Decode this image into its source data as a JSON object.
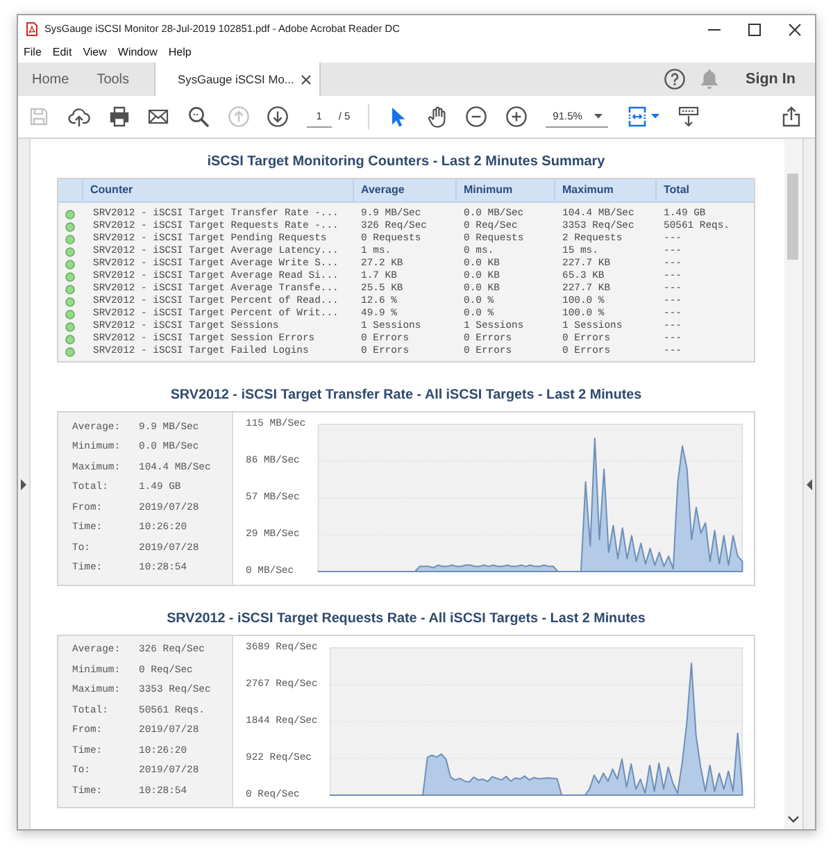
{
  "window": {
    "title": "SysGauge iSCSI Monitor 28-Jul-2019 102851.pdf - Adobe Acrobat Reader DC"
  },
  "menu": [
    "File",
    "Edit",
    "View",
    "Window",
    "Help"
  ],
  "tabs": [
    {
      "label": "Home",
      "kind": "nav",
      "selected": false
    },
    {
      "label": "Tools",
      "kind": "nav",
      "selected": false
    },
    {
      "label": "SysGauge iSCSI Mo...",
      "kind": "document",
      "selected": true
    }
  ],
  "account": {
    "sign_in": "Sign In"
  },
  "toolbar": {
    "file_tools": [
      {
        "kind": "save",
        "disabled": true
      },
      {
        "kind": "upload",
        "disabled": false
      },
      {
        "kind": "print",
        "disabled": false
      },
      {
        "kind": "email",
        "disabled": false
      },
      {
        "kind": "search",
        "disabled": false
      },
      {
        "kind": "previous_page",
        "disabled": true
      },
      {
        "kind": "next_page",
        "disabled": false
      }
    ],
    "page": {
      "value": "1",
      "total": "/ 5"
    },
    "view_tools": [
      {
        "kind": "select",
        "selected": true
      },
      {
        "kind": "hand",
        "selected": false
      },
      {
        "kind": "zoom_out",
        "selected": false
      },
      {
        "kind": "zoom_in",
        "selected": false
      }
    ],
    "zoom": {
      "value": "91.5%"
    },
    "display_tools": [
      {
        "kind": "page_display"
      },
      {
        "kind": "scroll_mode"
      }
    ],
    "end_tools": [
      {
        "kind": "share"
      }
    ]
  },
  "document": {
    "summary": {
      "title": "iSCSI Target Monitoring Counters - Last 2 Minutes Summary",
      "columns": [
        "Counter",
        "Average",
        "Minimum",
        "Maximum",
        "Total"
      ],
      "rows": [
        {
          "ok": true,
          "cells": [
            "SRV2012 - iSCSI Target Transfer Rate -...",
            "9.9 MB/Sec",
            "0.0 MB/Sec",
            "104.4 MB/Sec",
            "1.49 GB"
          ]
        },
        {
          "ok": true,
          "cells": [
            "SRV2012 - iSCSI Target Requests Rate -...",
            "326 Req/Sec",
            "0 Req/Sec",
            "3353 Req/Sec",
            "50561 Reqs."
          ]
        },
        {
          "ok": true,
          "cells": [
            "SRV2012 - iSCSI Target Pending Requests",
            "0 Requests",
            "0 Requests",
            "2 Requests",
            "---"
          ]
        },
        {
          "ok": true,
          "cells": [
            "SRV2012 - iSCSI Target Average Latency...",
            "1 ms.",
            "0 ms.",
            "15 ms.",
            "---"
          ]
        },
        {
          "ok": true,
          "cells": [
            "SRV2012 - iSCSI Target Average Write S...",
            "27.2 KB",
            "0.0 KB",
            "227.7 KB",
            "---"
          ]
        },
        {
          "ok": true,
          "cells": [
            "SRV2012 - iSCSI Target Average Read Si...",
            "1.7 KB",
            "0.0 KB",
            "65.3 KB",
            "---"
          ]
        },
        {
          "ok": true,
          "cells": [
            "SRV2012 - iSCSI Target Average Transfe...",
            "25.5 KB",
            "0.0 KB",
            "227.7 KB",
            "---"
          ]
        },
        {
          "ok": true,
          "cells": [
            "SRV2012 - iSCSI Target Percent of Read...",
            "12.6 %",
            "0.0 %",
            "100.0 %",
            "---"
          ]
        },
        {
          "ok": true,
          "cells": [
            "SRV2012 - iSCSI Target Percent of Writ...",
            "49.9 %",
            "0.0 %",
            "100.0 %",
            "---"
          ]
        },
        {
          "ok": true,
          "cells": [
            "SRV2012 - iSCSI Target Sessions",
            "1 Sessions",
            "1 Sessions",
            "1 Sessions",
            "---"
          ]
        },
        {
          "ok": true,
          "cells": [
            "SRV2012 - iSCSI Target Session Errors",
            "0 Errors",
            "0 Errors",
            "0 Errors",
            "---"
          ]
        },
        {
          "ok": true,
          "cells": [
            "SRV2012 - iSCSI Target Failed Logins",
            "0 Errors",
            "0 Errors",
            "0 Errors",
            "---"
          ]
        }
      ]
    },
    "charts": [
      {
        "stats": [
          {
            "label": "Average:",
            "value": "9.9 MB/Sec"
          },
          {
            "label": "Minimum:",
            "value": "0.0 MB/Sec"
          },
          {
            "label": "Maximum:",
            "value": "104.4 MB/Sec"
          },
          {
            "label": "Total:",
            "value": "1.49 GB"
          },
          {
            "label": "From:",
            "value": "2019/07/28"
          },
          {
            "label": "Time:",
            "value": "10:26:20"
          },
          {
            "label": "To:",
            "value": "2019/07/28"
          },
          {
            "label": "Time:",
            "value": "10:28:54"
          }
        ],
        "chart_data": {
          "type": "area",
          "title": "SRV2012 - iSCSI Target Transfer Rate - All iSCSI Targets - Last 2 Minutes",
          "grid": true,
          "ylim": [
            0,
            115
          ],
          "yticks": [
            {
              "value": 0,
              "label": "0 MB/Sec"
            },
            {
              "value": 28.75,
              "label": "29 MB/Sec"
            },
            {
              "value": 57.5,
              "label": "57 MB/Sec"
            },
            {
              "value": 86.25,
              "label": "86 MB/Sec"
            },
            {
              "value": 115,
              "label": "115 MB/Sec"
            }
          ],
          "values": [
            0,
            0,
            0,
            0,
            0,
            0,
            0,
            0,
            0,
            0,
            0,
            0,
            0,
            0,
            0,
            0,
            0,
            0,
            0,
            0,
            0,
            0,
            4,
            4,
            4,
            3,
            5,
            4,
            4,
            5,
            4,
            4,
            5,
            5,
            4,
            4,
            5,
            4,
            5,
            4,
            4,
            5,
            4,
            4,
            5,
            4,
            5,
            4,
            4,
            5,
            4,
            4,
            0,
            0,
            0,
            0,
            0,
            0,
            70,
            20,
            104,
            25,
            80,
            15,
            36,
            10,
            34,
            10,
            28,
            8,
            22,
            6,
            18,
            5,
            15,
            4,
            12,
            2,
            70,
            98,
            80,
            25,
            50,
            30,
            38,
            8,
            32,
            6,
            28,
            5,
            28,
            12,
            8
          ]
        }
      },
      {
        "stats": [
          {
            "label": "Average:",
            "value": "326 Req/Sec"
          },
          {
            "label": "Minimum:",
            "value": "0 Req/Sec"
          },
          {
            "label": "Maximum:",
            "value": "3353 Req/Sec"
          },
          {
            "label": "Total:",
            "value": "50561 Reqs."
          },
          {
            "label": "From:",
            "value": "2019/07/28"
          },
          {
            "label": "Time:",
            "value": "10:26:20"
          },
          {
            "label": "To:",
            "value": "2019/07/28"
          },
          {
            "label": "Time:",
            "value": "10:28:54"
          }
        ],
        "chart_data": {
          "type": "area",
          "title": "SRV2012 - iSCSI Target Requests Rate - All iSCSI Targets - Last 2 Minutes",
          "grid": true,
          "ylim": [
            0,
            3689
          ],
          "yticks": [
            {
              "value": 0,
              "label": "0 Req/Sec"
            },
            {
              "value": 922.25,
              "label": "922 Req/Sec"
            },
            {
              "value": 1844.5,
              "label": "1844 Req/Sec"
            },
            {
              "value": 2766.75,
              "label": "2767 Req/Sec"
            },
            {
              "value": 3689,
              "label": "3689 Req/Sec"
            }
          ],
          "values": [
            0,
            0,
            0,
            0,
            0,
            0,
            0,
            0,
            0,
            0,
            0,
            0,
            0,
            0,
            0,
            0,
            0,
            0,
            0,
            0,
            0,
            950,
            1000,
            950,
            1030,
            900,
            450,
            380,
            420,
            350,
            330,
            450,
            380,
            400,
            340,
            460,
            420,
            380,
            470,
            350,
            430,
            400,
            480,
            380,
            440,
            410,
            420,
            430,
            420,
            410,
            0,
            0,
            0,
            0,
            0,
            0,
            150,
            500,
            300,
            550,
            350,
            650,
            400,
            900,
            200,
            780,
            150,
            400,
            50,
            750,
            100,
            800,
            150,
            700,
            300,
            50,
            800,
            1800,
            3300,
            1500,
            700,
            100,
            750,
            100,
            550,
            150,
            600,
            100,
            1550,
            150
          ]
        }
      }
    ]
  }
}
